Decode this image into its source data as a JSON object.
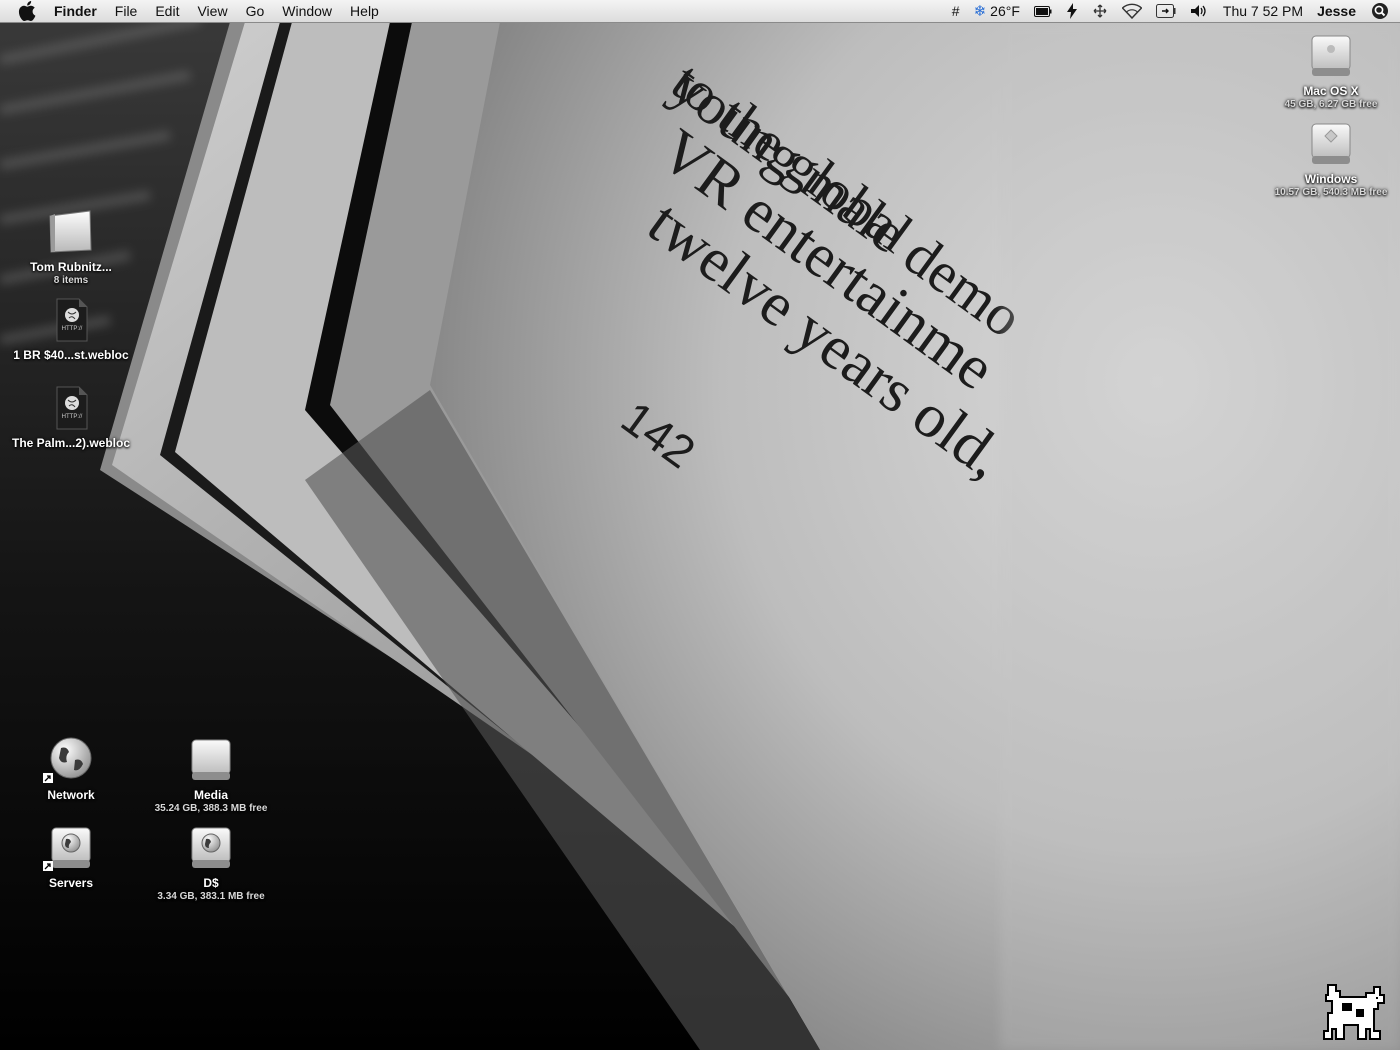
{
  "menubar": {
    "app_name": "Finder",
    "menus": [
      "File",
      "Edit",
      "View",
      "Go",
      "Window",
      "Help"
    ],
    "status": {
      "hash": "#",
      "temperature": "26°F",
      "clock": "Thu 7 52 PM",
      "user": "Jesse"
    },
    "icons": [
      "apple-icon",
      "snowflake-icon",
      "battery-icon",
      "sync-icon",
      "bluetooth-icon",
      "wifi-icon",
      "power-icon",
      "volume-icon",
      "spotlight-icon"
    ]
  },
  "wallpaper": {
    "lines": [
      "young male demo",
      "VR entertainme",
      "twelve years old,",
      "to the global"
    ],
    "page_number": "142"
  },
  "desktop": {
    "left_icons": [
      {
        "label": "Tom Rubnitz...",
        "sub": "8 items",
        "icon": "folder-icon"
      },
      {
        "label": "1 BR $40...st.webloc",
        "sub": "",
        "icon": "webloc-icon"
      },
      {
        "label": "The Palm...2).webloc",
        "sub": "",
        "icon": "webloc-icon"
      }
    ],
    "right_icons": [
      {
        "label": "Mac OS X",
        "sub": "45 GB, 6.27 GB free",
        "icon": "hard-drive-icon"
      },
      {
        "label": "Windows",
        "sub": "10.57 GB, 540.3 MB free",
        "icon": "hard-drive-icon"
      }
    ],
    "bottom_icons": [
      {
        "label": "Network",
        "sub": "",
        "icon": "network-globe-icon"
      },
      {
        "label": "Media",
        "sub": "35.24 GB, 388.3 MB free",
        "icon": "hard-drive-icon"
      },
      {
        "label": "Servers",
        "sub": "",
        "icon": "server-icon"
      },
      {
        "label": "D$",
        "sub": "3.34 GB, 383.1 MB free",
        "icon": "network-drive-icon"
      }
    ]
  },
  "colors": {
    "menubar_bg": "#e8e8e8",
    "desktop_text": "#ffffff"
  }
}
